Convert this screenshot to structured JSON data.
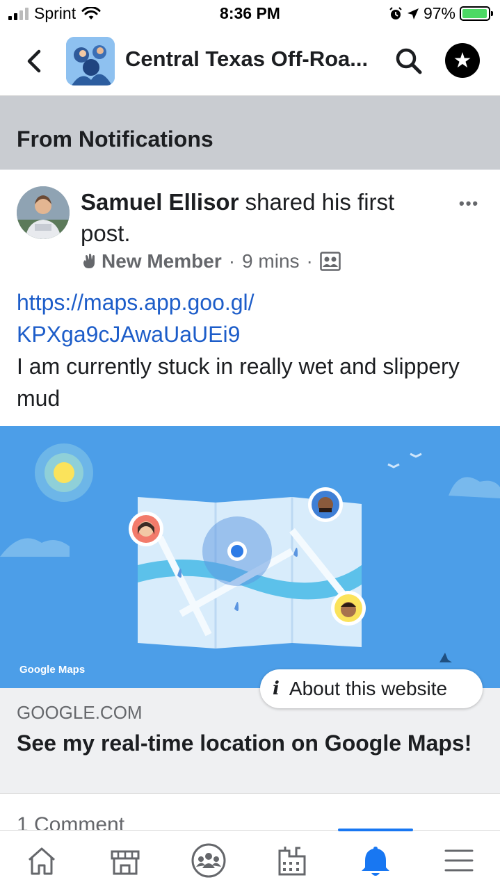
{
  "status_bar": {
    "carrier": "Sprint",
    "time": "8:36 PM",
    "battery_percent": "97%",
    "battery_level": 0.97
  },
  "header": {
    "title": "Central Texas Off-Roa...",
    "icons": [
      "back-icon",
      "search-icon",
      "shield-icon"
    ]
  },
  "section": {
    "title": "From Notifications"
  },
  "post": {
    "author": "Samuel Ellisor",
    "action": " shared his first post.",
    "badge": "New Member",
    "time": "9 mins",
    "link_line1": "https://maps.app.goo.gl/",
    "link_line2": "KPXga9cJAwaUaUEi9",
    "text": "I am currently stuck in really wet and slippery mud",
    "more": "•••"
  },
  "link_preview": {
    "image_caption": "Google Maps",
    "domain": "GOOGLE.COM",
    "title": "See my real-time location on Google Maps!",
    "about_label": "About this website",
    "about_icon": "i"
  },
  "comments": {
    "count_label": "1 Comment"
  },
  "bottom_nav": {
    "items": [
      "home-icon",
      "marketplace-icon",
      "groups-icon",
      "pages-icon",
      "notifications-icon",
      "menu-icon"
    ],
    "active": "notifications-icon",
    "active_color": "#1877f2"
  }
}
